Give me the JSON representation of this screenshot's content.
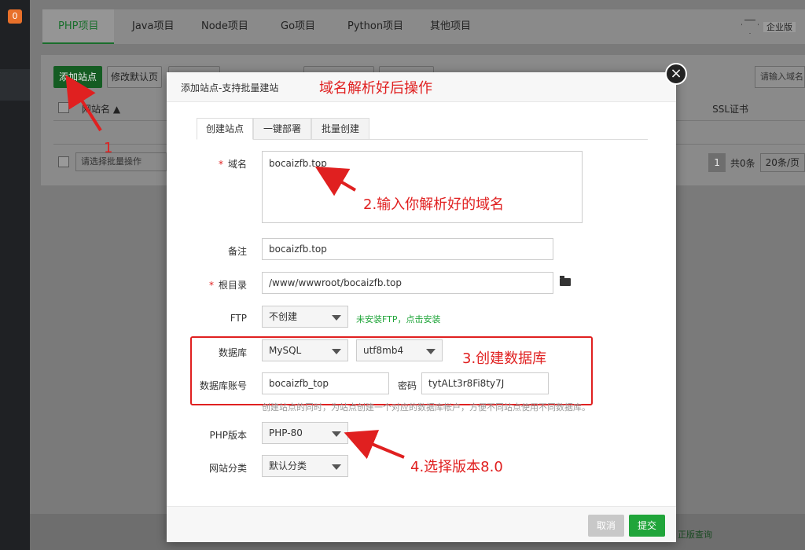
{
  "sidebar": {
    "badge": "0"
  },
  "topTabs": [
    "PHP项目",
    "Java项目",
    "Node项目",
    "Go项目",
    "Python项目",
    "其他项目"
  ],
  "edition": "企业版",
  "toolbar": {
    "add_site": "添加站点",
    "modify_default": "修改默认页",
    "search_placeholder": "请输入域名"
  },
  "table": {
    "col_site": "网站名 ▲",
    "col_ssl": "SSL证书",
    "batch_placeholder": "请选择批量操作"
  },
  "pager": {
    "page": "1",
    "total": "共0条",
    "page_size": "20条/页"
  },
  "footer_link": "正版查询",
  "modal": {
    "title": "添加站点-支持批量建站",
    "tabs": [
      "创建站点",
      "一键部署",
      "批量创建"
    ],
    "domain_label": "域名",
    "domain_value": "bocaizfb.top",
    "remark_label": "备注",
    "remark_value": "bocaizfb.top",
    "root_label": "根目录",
    "root_value": "/www/wwwroot/bocaizfb.top",
    "ftp_label": "FTP",
    "ftp_value": "不创建",
    "ftp_hint": "未安装FTP，点击安装",
    "db_label": "数据库",
    "db_type": "MySQL",
    "db_charset": "utf8mb4",
    "db_user_label": "数据库账号",
    "db_user_value": "bocaizfb_top",
    "db_pass_label": "密码",
    "db_pass_value": "tytALt3r8Fi8ty7J",
    "db_note": "创建站点的同时，为站点创建一个对应的数据库帐户，方便不同站点使用不同数据库。",
    "php_label": "PHP版本",
    "php_value": "PHP-80",
    "category_label": "网站分类",
    "category_value": "默认分类",
    "cancel": "取消",
    "submit": "提交"
  },
  "annotations": {
    "header": "域名解析好后操作",
    "step1": "1",
    "step2": "2.输入你解析好的域名",
    "step3": "3.创建数据库",
    "step4": "4.选择版本8.0"
  },
  "colors": {
    "green": "#20a53a",
    "red": "#e02020",
    "sidebar": "#1f2124"
  }
}
